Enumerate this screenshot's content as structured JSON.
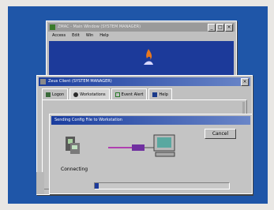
{
  "back_window": {
    "title": "ZMAC - Main Window (SYSTEM MANAGER)",
    "menu": [
      "Access",
      "Edit",
      "Win",
      "Help"
    ]
  },
  "front_window": {
    "title": "Zeus Client (SYSTEM MANAGER)",
    "tabs": [
      {
        "label": "Logon",
        "icon": "logon-icon"
      },
      {
        "label": "Workstations",
        "icon": "workstation-icon"
      },
      {
        "label": "Event Alert",
        "icon": "alert-icon"
      },
      {
        "label": "Help",
        "icon": "help-icon"
      }
    ]
  },
  "dialog": {
    "title": "Sending Config File to Workstation",
    "cancel_label": "Cancel",
    "status": "Connecting",
    "progress": 0.03
  },
  "colors": {
    "desktop": "#1f56a8",
    "titlebar": "#0a2a8a",
    "window": "#c0c0c0"
  }
}
